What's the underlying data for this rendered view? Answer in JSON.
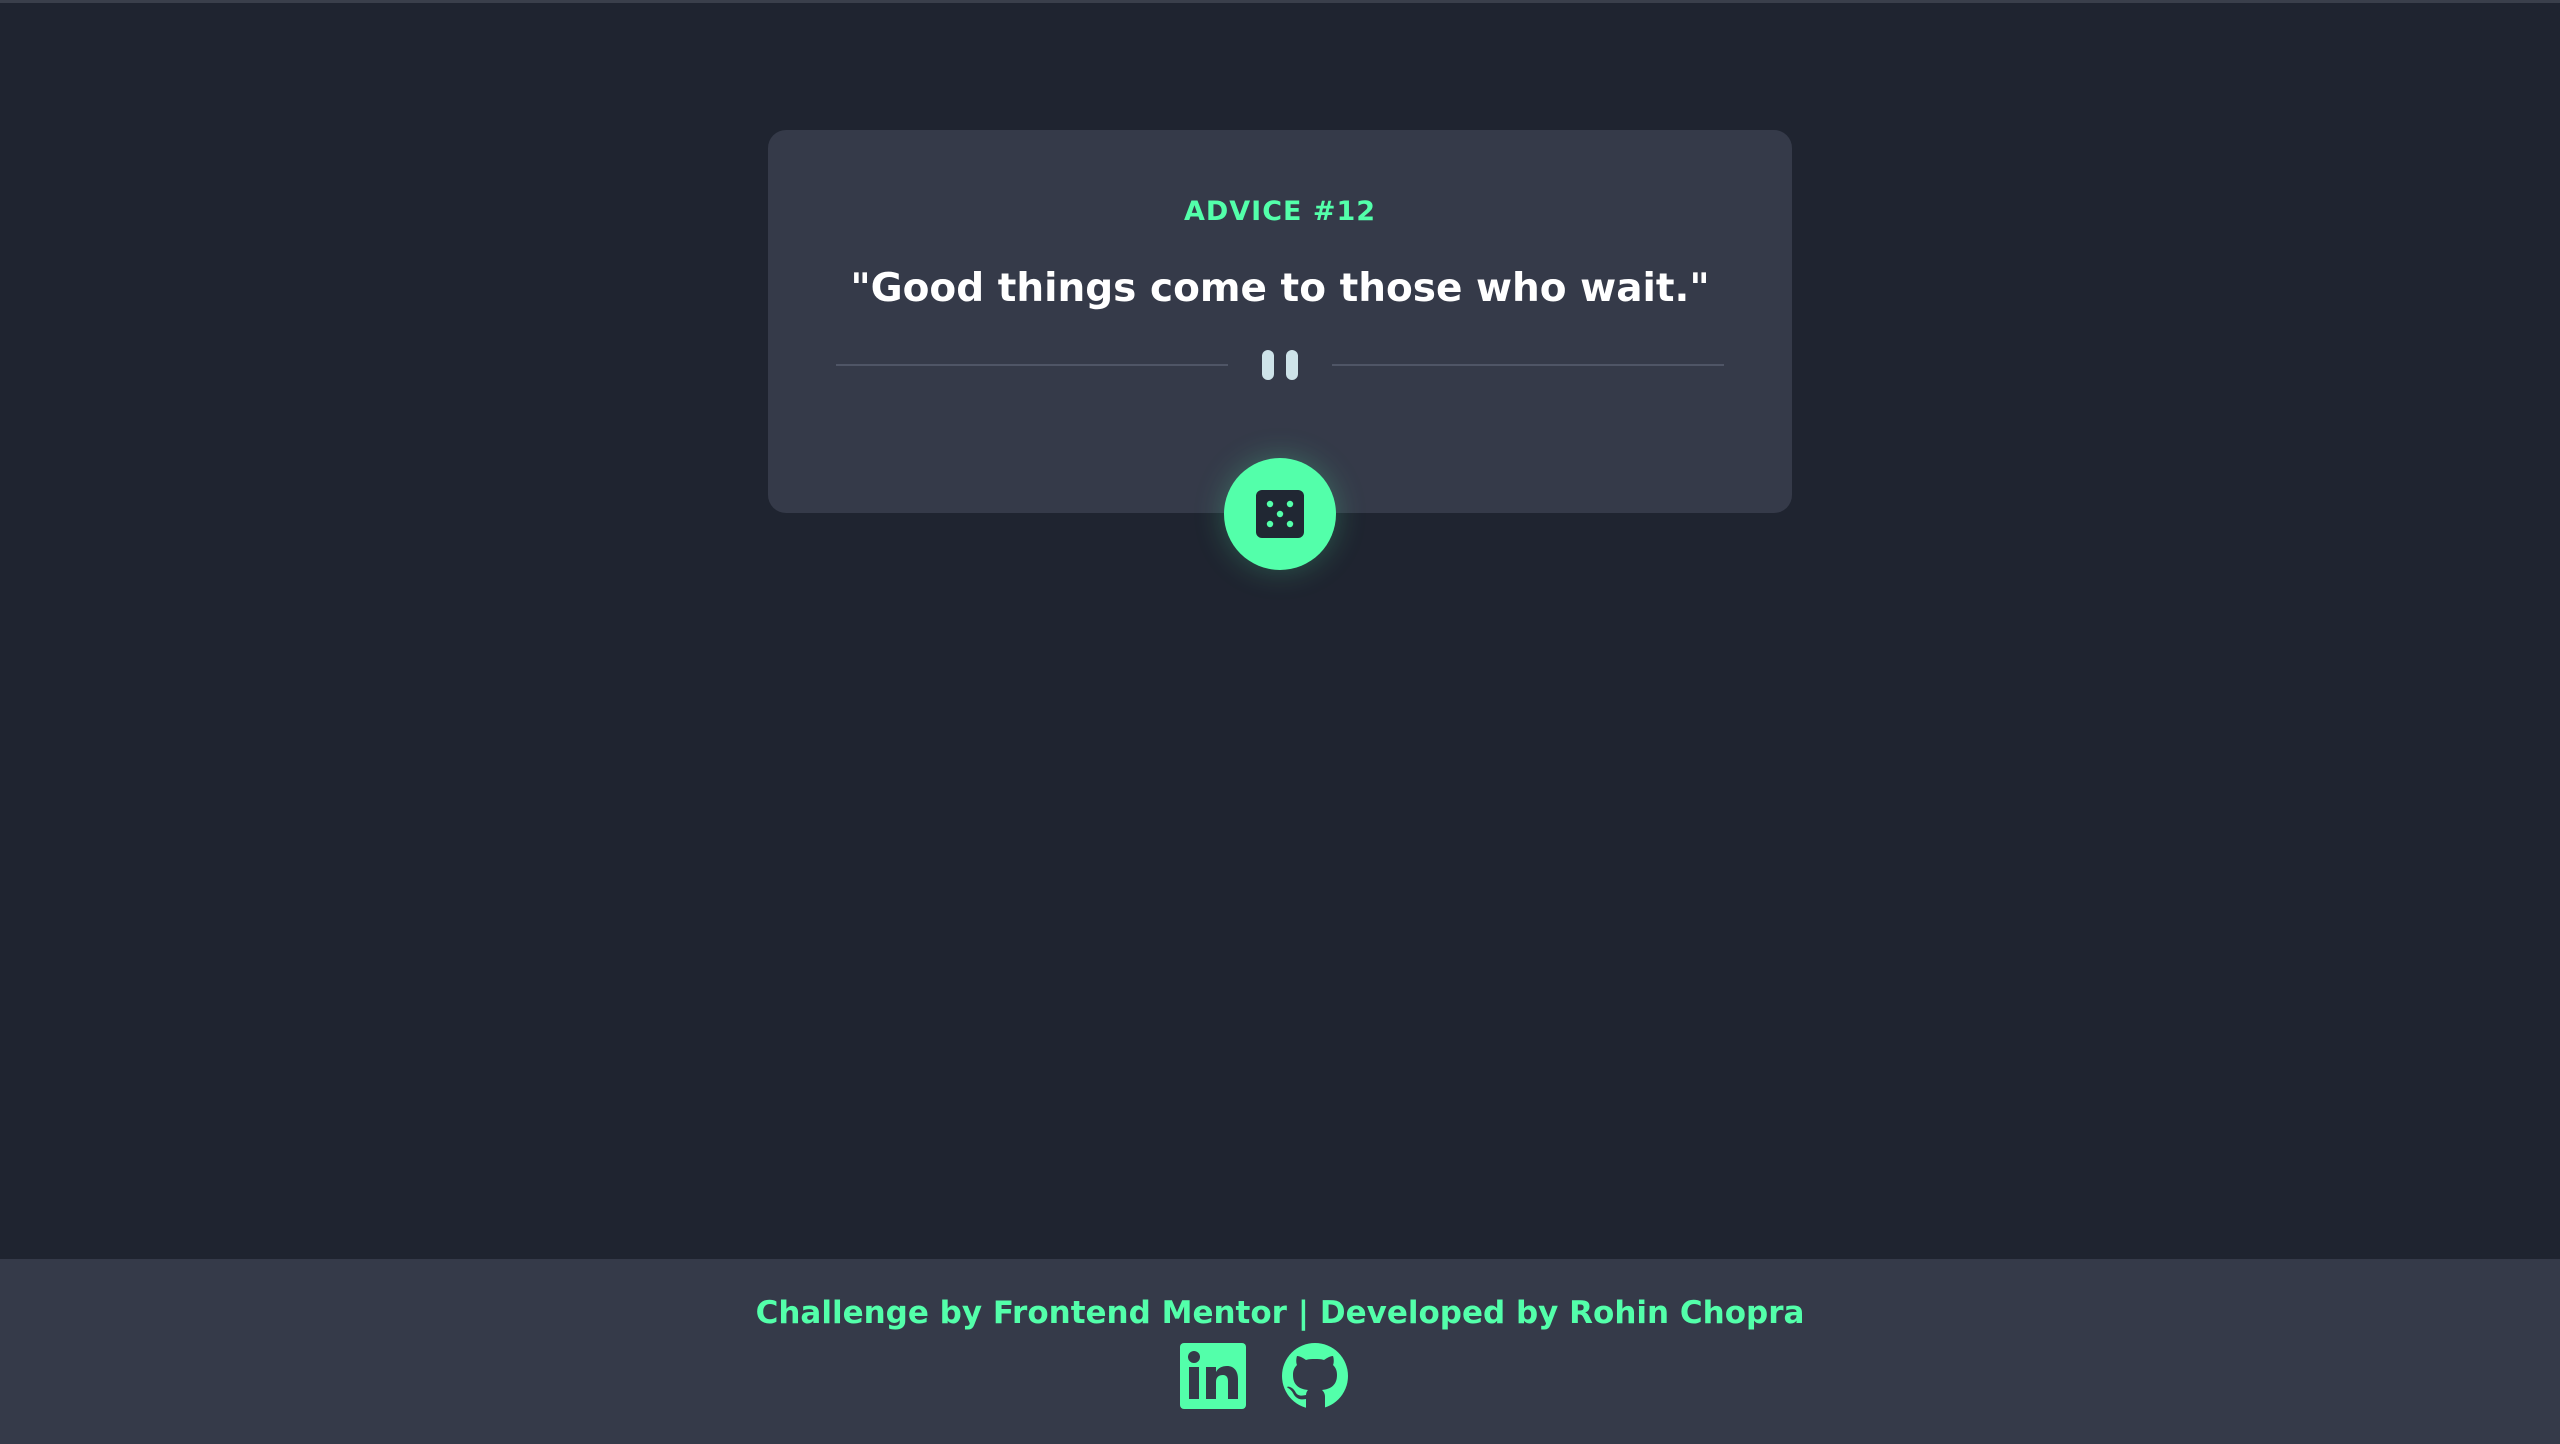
{
  "card": {
    "advice_number": "ADVICE #12",
    "advice_text": "\"Good things come to those who wait.\""
  },
  "icons": {
    "divider": "pause-icon",
    "generate": "dice-icon",
    "linkedin": "linkedin-icon",
    "github": "github-icon"
  },
  "footer": {
    "credit": "Challenge by Frontend Mentor | Developed by Rohin Chopra"
  },
  "colors": {
    "background": "#1f2430",
    "card": "#353a49",
    "accent": "#53ffaa",
    "text": "#ffffff"
  }
}
